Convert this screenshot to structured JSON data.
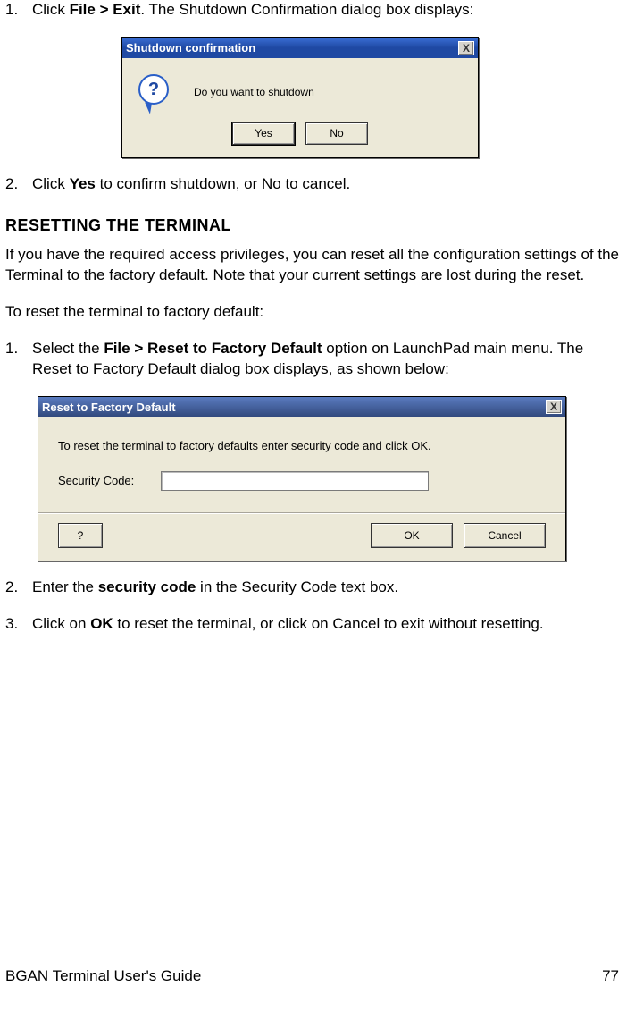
{
  "list1": {
    "item1": {
      "marker": "1.",
      "pre": "Click ",
      "bold": "File > Exit",
      "post": ". The Shutdown Confirmation dialog box displays:"
    },
    "item2": {
      "marker": "2.",
      "pre": "Click ",
      "bold": "Yes",
      "post": " to confirm shutdown, or No to cancel."
    }
  },
  "dialog1": {
    "title": "Shutdown confirmation",
    "close": "X",
    "qmark": "?",
    "message": "Do you want to shutdown",
    "yes": "Yes",
    "no": "No"
  },
  "section_heading": "RESETTING THE TERMINAL",
  "para1": "If you have the required access privileges, you can reset all the configuration settings of the Terminal to the factory default. Note that your current settings are lost during the reset.",
  "para2": "To reset the terminal to factory default:",
  "list2": {
    "item1": {
      "marker": "1.",
      "pre": "Select the ",
      "bold": "File > Reset to Factory Default",
      "post": " option on LaunchPad main menu. The Reset to Factory Default dialog box displays, as shown below:"
    },
    "item2": {
      "marker": "2.",
      "pre": "Enter the ",
      "bold": "security code",
      "post": " in the Security Code text box."
    },
    "item3": {
      "marker": "3.",
      "pre": "Click on ",
      "bold": "OK",
      "post": " to reset the terminal, or click on Cancel to exit without resetting."
    }
  },
  "dialog2": {
    "title": "Reset to Factory Default",
    "close": "X",
    "message": "To reset the terminal to factory defaults enter security code and click OK.",
    "field_label": "Security Code:",
    "help": "?",
    "ok": "OK",
    "cancel": "Cancel"
  },
  "footer": {
    "left": "BGAN Terminal User's Guide",
    "right": "77"
  }
}
